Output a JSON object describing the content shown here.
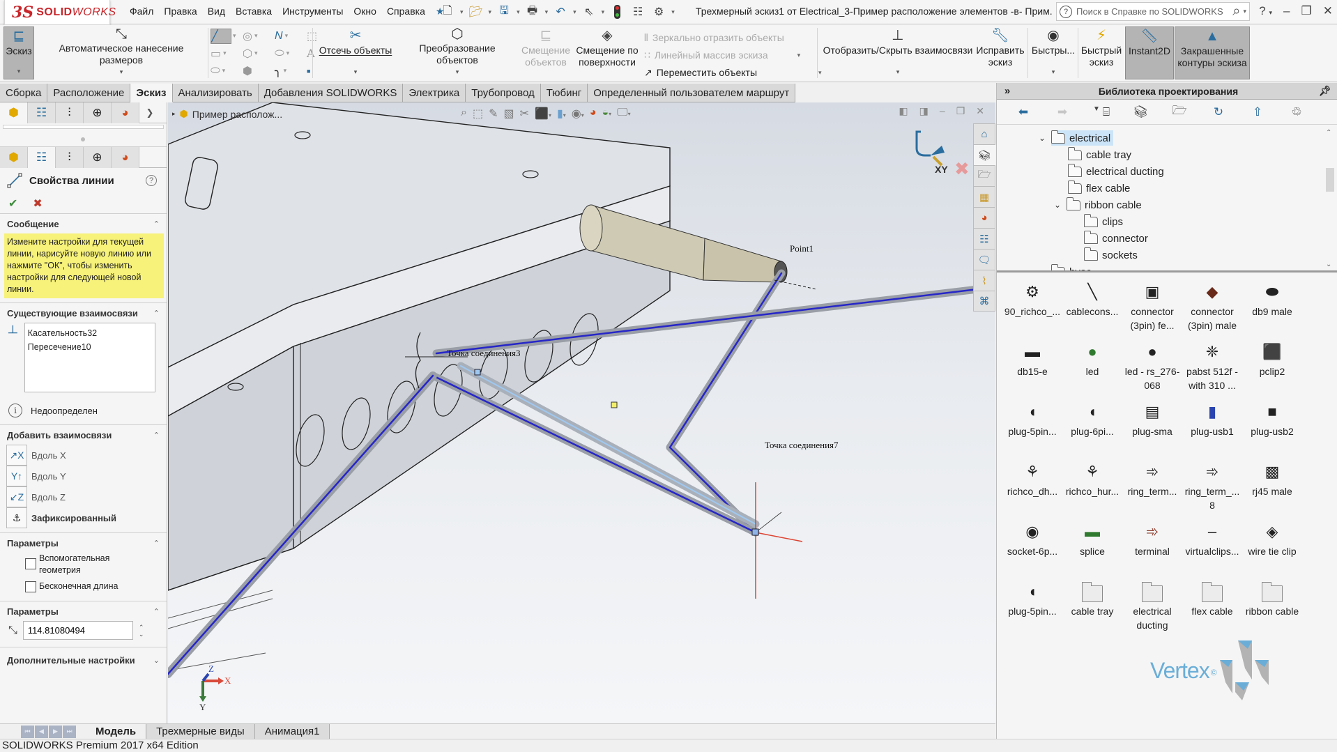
{
  "app": {
    "logo_ds": "3S",
    "logo_brand_bold": "SOLID",
    "logo_brand_light": "WORKS",
    "menu": [
      "Файл",
      "Правка",
      "Вид",
      "Вставка",
      "Инструменты",
      "Окно",
      "Справка"
    ],
    "document_title": "Трехмерный эскиз1 от Electrical_3-Пример расположение элементов -в- Прим...",
    "help_search_placeholder": "Поиск в Справке по SOLIDWORKS",
    "help_label": "?",
    "window_controls": [
      "minimize",
      "restore",
      "close"
    ]
  },
  "quick_access": [
    "new-document-icon",
    "open-icon",
    "save-icon",
    "print-icon",
    "undo-icon",
    "select-icon",
    "rebuild-icon",
    "file-properties-icon",
    "options-icon"
  ],
  "ribbon": {
    "sketch": "Эскиз",
    "smart_dimension": "Автоматическое нанесение размеров",
    "trim": "Отсечь объекты",
    "convert": "Преобразование объектов",
    "offset_line1": "Смещение",
    "offset_line2": "объектов",
    "offset_surface_line1": "Смещение по",
    "offset_surface_line2": "поверхности",
    "mirror": "Зеркально отразить объекты",
    "linear_pattern": "Линейный массив эскиза",
    "move": "Переместить объекты",
    "show_hide_relations": "Отобразить/Скрыть взаимосвязи",
    "repair_line1": "Исправить",
    "repair_line2": "эскиз",
    "quick_snaps": "Быстры...",
    "rapid_sketch_line1": "Быстрый",
    "rapid_sketch_line2": "эскиз",
    "instant2d": "Instant2D",
    "shaded_line1": "Закрашенные",
    "shaded_line2": "контуры эскиза"
  },
  "command_tabs": [
    {
      "label": "Сборка",
      "active": false
    },
    {
      "label": "Расположение",
      "active": false
    },
    {
      "label": "Эскиз",
      "active": true
    },
    {
      "label": "Анализировать",
      "active": false
    },
    {
      "label": "Добавления SOLIDWORKS",
      "active": false
    },
    {
      "label": "Электрика",
      "active": false
    },
    {
      "label": "Трубопровод",
      "active": false
    },
    {
      "label": "Тюбинг",
      "active": false
    },
    {
      "label": "Определенный пользователем маршрут",
      "active": false
    }
  ],
  "property_manager": {
    "title": "Свойства линии",
    "message_header": "Сообщение",
    "message": "Измените настройки для текущей линии, нарисуйте новую линию или нажмите \"ОК\", чтобы изменить настройки для следующей новой линии.",
    "existing_relations_header": "Существующие взаимосвязи",
    "existing_relations": [
      "Касательность32",
      "Пересечение10"
    ],
    "status": "Недоопределен",
    "add_relations_header": "Добавить взаимосвязи",
    "add_relations": [
      "Вдоль X",
      "Вдоль Y",
      "Вдоль Z",
      "Зафиксированный"
    ],
    "options_header": "Параметры",
    "option_construction": "Вспомогательная геометрия",
    "option_construction_checked": false,
    "option_infinite": "Бесконечная длина",
    "option_infinite_checked": false,
    "parameters_header": "Параметры",
    "length_value": "114.81080494",
    "additional_header": "Дополнительные настройки"
  },
  "viewport": {
    "breadcrumb": "Пример располож...",
    "labels": {
      "point1": "Point1",
      "connection3": "Точка соединения3",
      "connection7": "Точка соединения7",
      "sketch_plane": "XY"
    },
    "triad": {
      "x": "X",
      "y": "Y",
      "z": "Z"
    }
  },
  "task_pane_tabs": [
    "home-icon",
    "design-library-icon",
    "file-explorer-icon",
    "view-palette-icon",
    "appearances-icon",
    "custom-properties-icon",
    "forum-icon",
    "electrical-icon",
    "routing-library-icon"
  ],
  "design_library": {
    "title": "Библиотека проектирования",
    "tree": [
      {
        "label": "electrical",
        "level": 0,
        "expanded": true,
        "selected": true
      },
      {
        "label": "cable tray",
        "level": 1
      },
      {
        "label": "electrical ducting",
        "level": 1
      },
      {
        "label": "flex cable",
        "level": 1
      },
      {
        "label": "ribbon cable",
        "level": 1,
        "expanded": true
      },
      {
        "label": "clips",
        "level": 2
      },
      {
        "label": "connector",
        "level": 2
      },
      {
        "label": "sockets",
        "level": 2
      },
      {
        "label": "hvac",
        "level": 0,
        "expanded": false
      }
    ],
    "items": [
      {
        "label": "90_richco_...",
        "type": "part"
      },
      {
        "label": "cablecons...",
        "type": "part"
      },
      {
        "label": "connector (3pin) fe...",
        "type": "part"
      },
      {
        "label": "connector (3pin) male",
        "type": "part"
      },
      {
        "label": "db9 male",
        "type": "part"
      },
      {
        "label": "db15-e",
        "type": "part"
      },
      {
        "label": "led",
        "type": "part"
      },
      {
        "label": "led - rs_276-068",
        "type": "part"
      },
      {
        "label": "pabst 512f - with 310 ...",
        "type": "part"
      },
      {
        "label": "pclip2",
        "type": "part"
      },
      {
        "label": "plug-5pin...",
        "type": "part"
      },
      {
        "label": "plug-6pi...",
        "type": "part"
      },
      {
        "label": "plug-sma",
        "type": "part"
      },
      {
        "label": "plug-usb1",
        "type": "part"
      },
      {
        "label": "plug-usb2",
        "type": "part"
      },
      {
        "label": "richco_dh...",
        "type": "part"
      },
      {
        "label": "richco_hur...",
        "type": "part"
      },
      {
        "label": "ring_term...",
        "type": "part"
      },
      {
        "label": "ring_term_... 8",
        "type": "part"
      },
      {
        "label": "rj45 male",
        "type": "part"
      },
      {
        "label": "socket-6p...",
        "type": "part"
      },
      {
        "label": "splice",
        "type": "part"
      },
      {
        "label": "terminal",
        "type": "part"
      },
      {
        "label": "virtualclips...",
        "type": "part"
      },
      {
        "label": "wire tie clip",
        "type": "part"
      },
      {
        "label": "plug-5pin...",
        "type": "part"
      },
      {
        "label": "cable tray",
        "type": "folder"
      },
      {
        "label": "electrical ducting",
        "type": "folder"
      },
      {
        "label": "flex cable",
        "type": "folder"
      },
      {
        "label": "ribbon cable",
        "type": "folder"
      }
    ],
    "watermark": "Vertex",
    "watermark_mark": "©"
  },
  "bottom_tabs": [
    {
      "label": "Модель",
      "active": true
    },
    {
      "label": "Трехмерные виды",
      "active": false
    },
    {
      "label": "Анимация1",
      "active": false
    }
  ],
  "status_bar": "SOLIDWORKS Premium 2017 x64 Edition",
  "colors": {
    "brand_red": "#c8262b",
    "message_yellow": "#f7f27a",
    "route_blue": "#2626c8",
    "selection_blue": "#cce4f7"
  }
}
